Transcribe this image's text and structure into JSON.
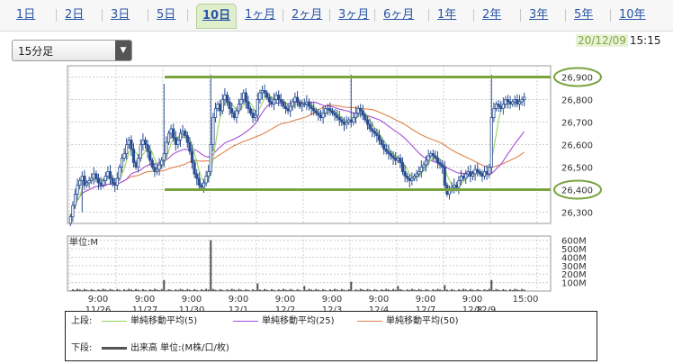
{
  "tabs": [
    {
      "label": "1日",
      "active": false
    },
    {
      "label": "2日",
      "active": false
    },
    {
      "label": "3日",
      "active": false
    },
    {
      "label": "5日",
      "active": false
    },
    {
      "label": "10日",
      "active": true
    },
    {
      "label": "1ヶ月",
      "active": false
    },
    {
      "label": "2ヶ月",
      "active": false
    },
    {
      "label": "3ヶ月",
      "active": false
    },
    {
      "label": "6ヶ月",
      "active": false
    },
    {
      "label": "1年",
      "active": false
    },
    {
      "label": "2年",
      "active": false
    },
    {
      "label": "3年",
      "active": false
    },
    {
      "label": "5年",
      "active": false
    },
    {
      "label": "10年",
      "active": false
    }
  ],
  "period_select": {
    "value": "15分足"
  },
  "timestamp": {
    "date": "20/12/09",
    "time": "15:15"
  },
  "legend": {
    "upper_label": "上段:",
    "lower_label": "下段:",
    "ma5": "単純移動平均(5)",
    "ma25": "単純移動平均(25)",
    "ma50": "単純移動平均(50)",
    "volume": "出来高 単位:(M株/口/枚)"
  },
  "colors": {
    "candle": "#2a4e92",
    "wick": "#2a4e92",
    "ma5": "#9cd35e",
    "ma25": "#a64ed6",
    "ma50": "#e0824a",
    "volume": "#555555",
    "highlight": "#7aa340",
    "grid": "#cccccc"
  },
  "chart_data": [
    {
      "type": "candlestick",
      "title": "",
      "ylim": [
        26250,
        26950
      ],
      "yticks": [
        "26,300",
        "26,400",
        "26,500",
        "26,600",
        "26,700",
        "26,800",
        "26,900"
      ],
      "ytick_values": [
        26300,
        26400,
        26500,
        26600,
        26700,
        26800,
        26900
      ],
      "x_label_rows": [
        [
          "9:00",
          "9:00",
          "9:00",
          "9:00",
          "9:00",
          "9:00",
          "9:00",
          "9:00",
          "9:00",
          "15:00"
        ],
        [
          "11/26",
          "11/27",
          "11/30",
          "12/1",
          "12/2",
          "12/3",
          "12/4",
          "12/7",
          "12/8",
          "12/9"
        ]
      ],
      "session_bars": 20,
      "total_bars": 205,
      "close": [
        26280,
        26330,
        26380,
        26420,
        26440,
        26460,
        26420,
        26430,
        26440,
        26450,
        26470,
        26450,
        26430,
        26420,
        26440,
        26460,
        26480,
        26450,
        26430,
        26420,
        26450,
        26500,
        26540,
        26560,
        26600,
        26620,
        26580,
        26520,
        26500,
        26540,
        26600,
        26620,
        26600,
        26570,
        26530,
        26500,
        26480,
        26490,
        26510,
        26530,
        26560,
        26610,
        26650,
        26670,
        26630,
        26600,
        26620,
        26650,
        26660,
        26640,
        26610,
        26570,
        26520,
        26470,
        26450,
        26420,
        26410,
        26430,
        26460,
        26480,
        26600,
        26720,
        26760,
        26780,
        26750,
        26800,
        26820,
        26790,
        26760,
        26740,
        26720,
        26750,
        26780,
        26800,
        26830,
        26790,
        26760,
        26740,
        26720,
        26730,
        26800,
        26830,
        26840,
        26830,
        26810,
        26790,
        26780,
        26800,
        26820,
        26800,
        26790,
        26770,
        26760,
        26750,
        26770,
        26790,
        26810,
        26790,
        26770,
        26780,
        26780,
        26790,
        26770,
        26760,
        26750,
        26740,
        26730,
        26720,
        26740,
        26760,
        26760,
        26750,
        26740,
        26730,
        26720,
        26710,
        26700,
        26690,
        26700,
        26710,
        26700,
        26720,
        26740,
        26760,
        26750,
        26730,
        26710,
        26690,
        26670,
        26660,
        26650,
        26640,
        26620,
        26600,
        26580,
        26570,
        26560,
        26550,
        26540,
        26530,
        26540,
        26520,
        26480,
        26460,
        26450,
        26440,
        26450,
        26460,
        26470,
        26480,
        26500,
        26510,
        26530,
        26550,
        26560,
        26550,
        26540,
        26520,
        26510,
        26500,
        26420,
        26380,
        26400,
        26410,
        26420,
        26410,
        26440,
        26460,
        26450,
        26470,
        26480,
        26460,
        26470,
        26490,
        26480,
        26470,
        26460,
        26480,
        26470,
        26500,
        26720,
        26760,
        26780,
        26770,
        26760,
        26780,
        26800,
        26790,
        26780,
        26790,
        26800,
        26780,
        26790,
        26800,
        26810
      ],
      "high_points": [
        [
          60,
          26910
        ],
        [
          40,
          26870
        ],
        [
          120,
          26910
        ],
        [
          180,
          26910
        ],
        [
          0,
          26250
        ],
        [
          5,
          26300
        ]
      ],
      "ma5_last": 26790,
      "ma25_last": 26710,
      "ma50_last": 26600,
      "volume_ylim": [
        0,
        650
      ],
      "volume_yticks": [
        "100M",
        "200M",
        "300M",
        "400M",
        "500M",
        "600M"
      ],
      "volume_ytick_values": [
        100,
        200,
        300,
        400,
        500,
        600
      ],
      "volume_unit_label": "単位:M",
      "volume_spikes": [
        [
          40,
          130
        ],
        [
          60,
          600
        ],
        [
          80,
          90
        ],
        [
          100,
          60
        ],
        [
          120,
          110
        ],
        [
          140,
          60
        ],
        [
          160,
          70
        ],
        [
          180,
          130
        ],
        [
          195,
          60
        ]
      ],
      "highlight_levels": [
        26900,
        26400
      ],
      "highlight_labels": [
        "26,900",
        "26,400"
      ]
    }
  ]
}
